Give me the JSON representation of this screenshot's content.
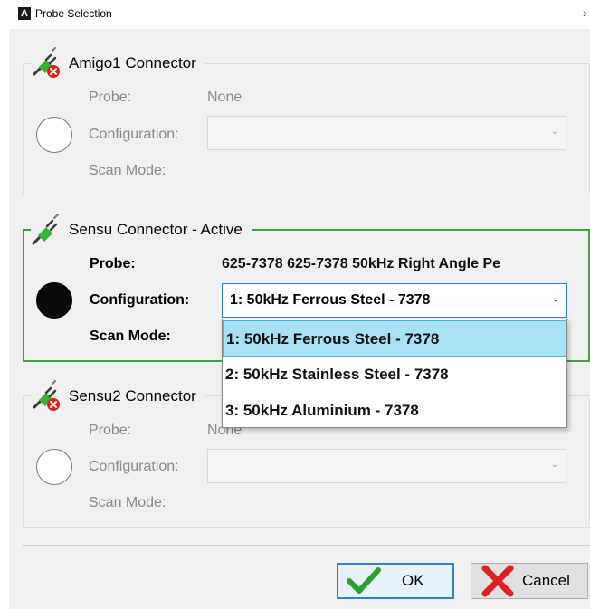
{
  "window": {
    "title": "Probe Selection",
    "app_icon_letter": "A",
    "menu_chevron": "›"
  },
  "connectors": [
    {
      "name": "Amigo1 Connector",
      "status": "disconnected",
      "icon": "plug-disconnected-icon",
      "probe_label": "Probe:",
      "probe_value": "None",
      "configuration_label": "Configuration:",
      "configuration_value": "",
      "scan_mode_label": "Scan Mode:",
      "selected": false
    },
    {
      "name": "Sensu Connector - Active",
      "status": "active",
      "icon": "plug-connected-icon",
      "probe_label": "Probe:",
      "probe_value": "625-7378 625-7378 50kHz Right Angle Pe",
      "configuration_label": "Configuration:",
      "configuration_value": "1: 50kHz Ferrous Steel - 7378",
      "scan_mode_label": "Scan Mode:",
      "selected": true
    },
    {
      "name": "Sensu2 Connector",
      "status": "disconnected",
      "icon": "plug-disconnected-icon",
      "probe_label": "Probe:",
      "probe_value": "None",
      "configuration_label": "Configuration:",
      "configuration_value": "",
      "scan_mode_label": "Scan Mode:",
      "selected": false
    }
  ],
  "configuration_dropdown": {
    "options": [
      "1: 50kHz Ferrous Steel - 7378",
      "2: 50kHz Stainless Steel - 7378",
      "3: 50kHz Aluminium - 7378"
    ],
    "selected_index": 0
  },
  "buttons": {
    "ok_label": "OK",
    "cancel_label": "Cancel"
  },
  "colors": {
    "active_border": "#3aa53a",
    "selection_highlight": "#a8e0f5",
    "ok_check": "#2aa12a",
    "cancel_x": "#e02020"
  }
}
